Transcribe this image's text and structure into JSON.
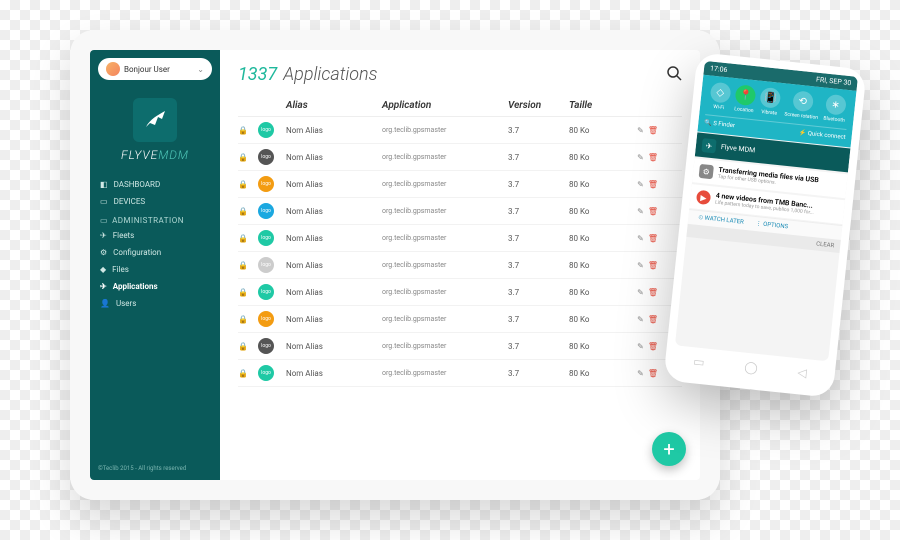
{
  "user": {
    "greeting": "Bonjour User"
  },
  "brand": {
    "name1": "FLYVE",
    "name2": "MDM"
  },
  "nav": {
    "dashboard": "DASHBOARD",
    "devices": "DEVICES",
    "admin_header": "ADMINISTRATION",
    "fleets": "Fleets",
    "configuration": "Configuration",
    "files": "Files",
    "applications": "Applications",
    "users": "Users"
  },
  "footer": "©Teclib 2015 - All rights reserved",
  "page": {
    "count": "1337",
    "title": "Applications"
  },
  "columns": {
    "alias": "Alias",
    "application": "Application",
    "version": "Version",
    "taille": "Taille"
  },
  "rows": [
    {
      "color": "#1fc9a5",
      "alias": "Nom Alias",
      "app": "org.teclib.gpsmaster",
      "version": "3.7",
      "size": "80 Ko"
    },
    {
      "color": "#555555",
      "alias": "Nom Alias",
      "app": "org.teclib.gpsmaster",
      "version": "3.7",
      "size": "80 Ko"
    },
    {
      "color": "#f39c12",
      "alias": "Nom Alias",
      "app": "org.teclib.gpsmaster",
      "version": "3.7",
      "size": "80 Ko"
    },
    {
      "color": "#1ba8e0",
      "alias": "Nom Alias",
      "app": "org.teclib.gpsmaster",
      "version": "3.7",
      "size": "80 Ko"
    },
    {
      "color": "#1fc9a5",
      "alias": "Nom Alias",
      "app": "org.teclib.gpsmaster",
      "version": "3.7",
      "size": "80 Ko"
    },
    {
      "color": "#cccccc",
      "alias": "Nom Alias",
      "app": "org.teclib.gpsmaster",
      "version": "3.7",
      "size": "80 Ko"
    },
    {
      "color": "#1fc9a5",
      "alias": "Nom Alias",
      "app": "org.teclib.gpsmaster",
      "version": "3.7",
      "size": "80 Ko"
    },
    {
      "color": "#f39c12",
      "alias": "Nom Alias",
      "app": "org.teclib.gpsmaster",
      "version": "3.7",
      "size": "80 Ko"
    },
    {
      "color": "#555555",
      "alias": "Nom Alias",
      "app": "org.teclib.gpsmaster",
      "version": "3.7",
      "size": "80 Ko"
    },
    {
      "color": "#1fc9a5",
      "alias": "Nom Alias",
      "app": "org.teclib.gpsmaster",
      "version": "3.7",
      "size": "80 Ko"
    }
  ],
  "chip_label": "logo",
  "phone": {
    "time": "17:06",
    "date": "FRI, SEP 30",
    "qs": {
      "wifi": "Wi-Fi",
      "location": "Location",
      "vibrate": "Vibrate",
      "screen": "Screen rotation",
      "bluetooth": "Bluetooth"
    },
    "sfinder": "S Finder",
    "quickconnect": "Quick connect",
    "app_notif": "Flyve MDM",
    "n1_title": "Transferring media files via USB",
    "n1_sub": "Tap for other USB options.",
    "n2_title": "4 new videos from TMB Banc...",
    "n2_sub": "Life pattern today to save, publico 1,000 for...",
    "watch": "WATCH LATER",
    "options": "OPTIONS",
    "clear": "CLEAR"
  }
}
